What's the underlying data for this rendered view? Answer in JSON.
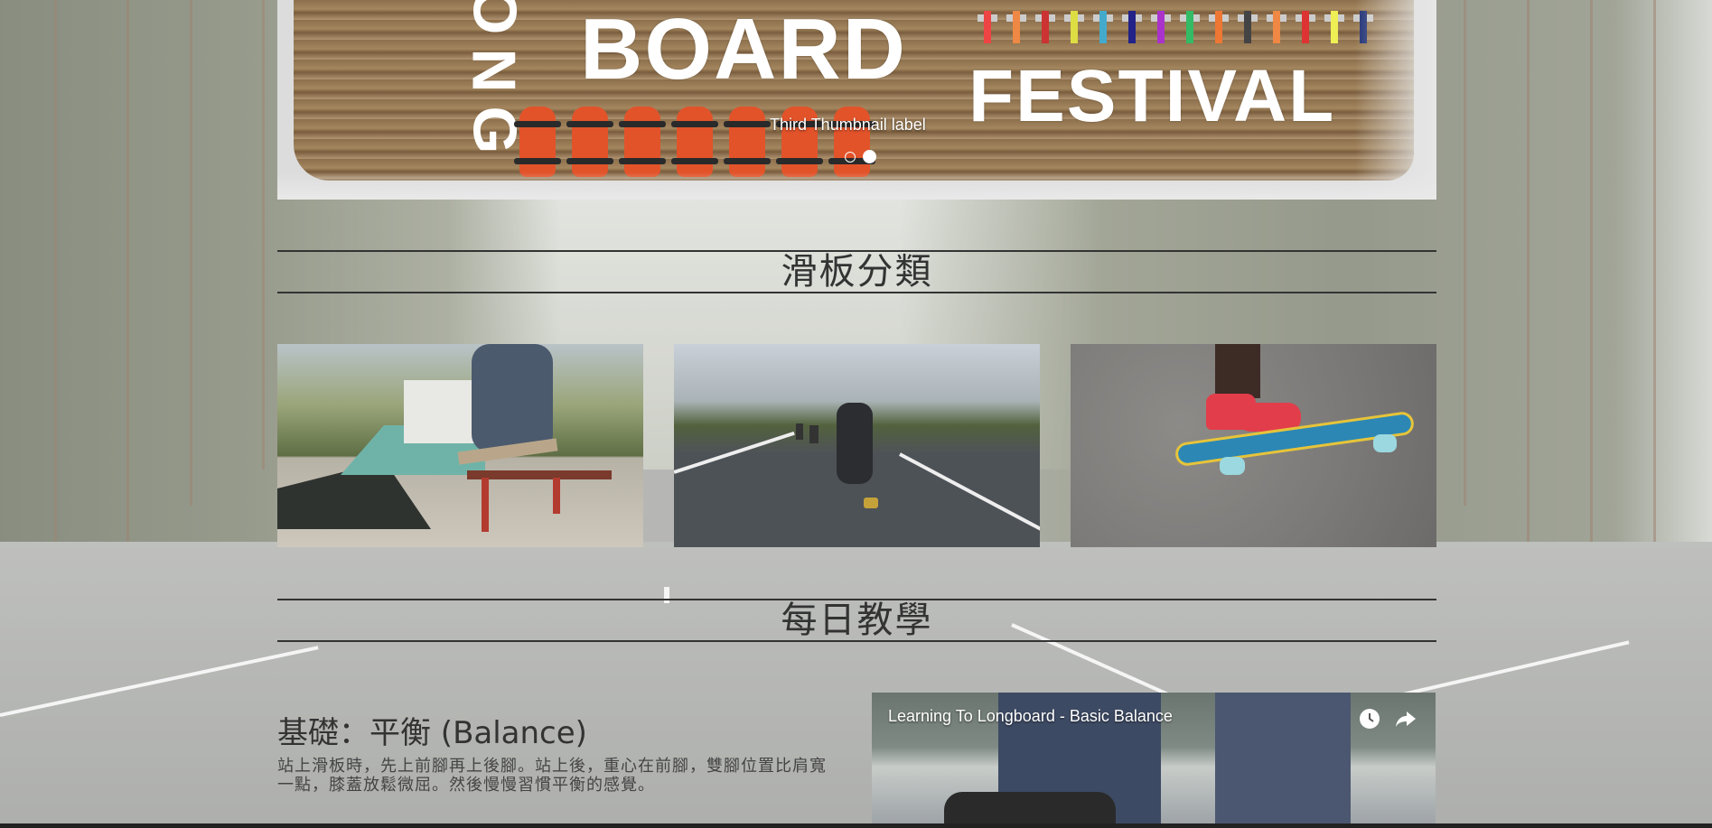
{
  "carousel": {
    "banner_word_board": "BOARD",
    "banner_word_festival": "FESTIVAL",
    "banner_vertical_letters": [
      "O",
      "N",
      "G"
    ],
    "caption": "Third Thumbnail label",
    "indicators": 2,
    "active_indicator": 2
  },
  "sections": {
    "categories_heading": "滑板分類",
    "daily_heading": "每日教學"
  },
  "tutorial": {
    "title": "基礎：平衡 (Balance)",
    "text": "站上滑板時，先上前腳再上後腳。站上後，重心在前腳，雙腳位置比肩寬一點，膝蓋放鬆微屈。然後慢慢習慣平衡的感覺。",
    "video_title": "Learning To Longboard - Basic Balance",
    "watch_later_icon": "clock-icon",
    "share_icon": "share-icon"
  },
  "thumbnails": [
    {
      "subject": "street-skate-rail"
    },
    {
      "subject": "downhill-longboard"
    },
    {
      "subject": "penny-board-red-shoes"
    }
  ]
}
